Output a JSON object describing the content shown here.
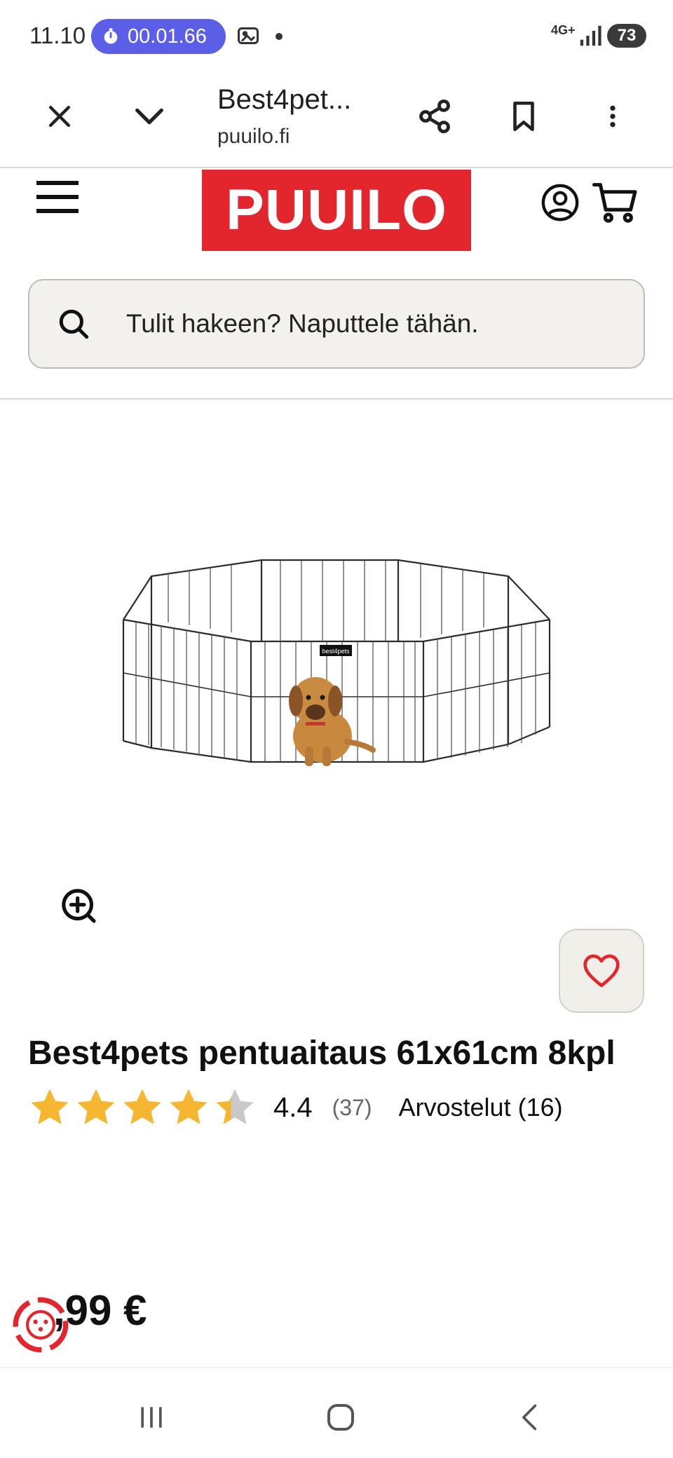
{
  "status_bar": {
    "time": "11.10",
    "timer": "00.01.66",
    "network": "4G+",
    "battery": "73"
  },
  "browser": {
    "tab_title": "Best4pet...",
    "url": "puuilo.fi",
    "icons": [
      "close-icon",
      "chevron-down-icon",
      "share-icon",
      "bookmark-icon",
      "more-vert-icon"
    ]
  },
  "site": {
    "logo_text": "PUUILO",
    "brand_color": "#e3262e",
    "search_placeholder": "Tulit hakeen? Naputtele tähän."
  },
  "product": {
    "title": "Best4pets pentuaitaus 61x61cm 8kpl",
    "rating": "4.4",
    "rating_value": 4.4,
    "rating_max": 5,
    "rating_count": "(37)",
    "reviews_label": "Arvostelut (16)",
    "price": ",99 €",
    "star_color": "#f5b731",
    "image_label": "best4pets"
  },
  "nav": {
    "icons": [
      "recents-icon",
      "home-icon",
      "back-icon"
    ]
  }
}
